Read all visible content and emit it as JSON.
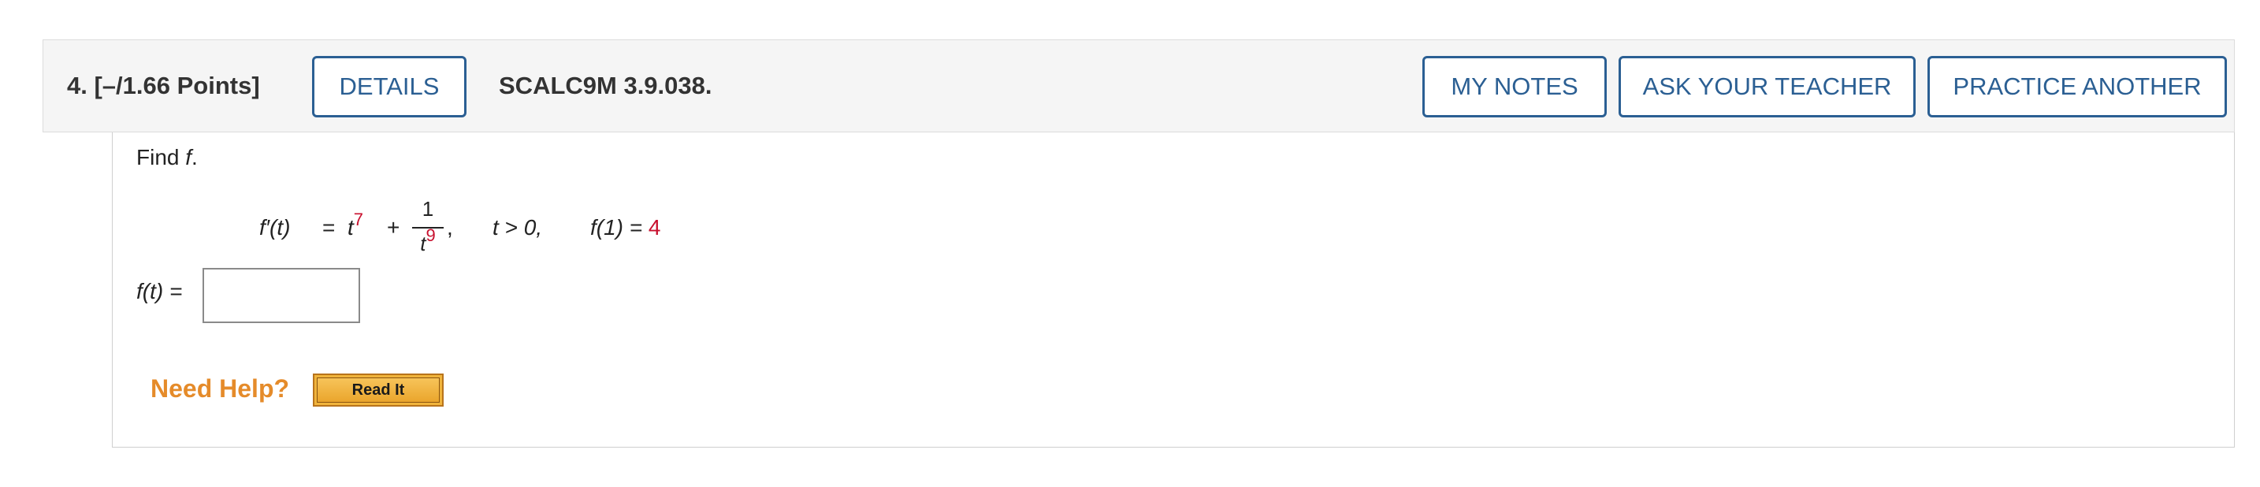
{
  "question": {
    "number_label": "4.",
    "points_label": "[–/1.66 Points]",
    "code": "SCALC9M 3.9.038."
  },
  "buttons": {
    "details": "DETAILS",
    "my_notes": "MY NOTES",
    "ask_teacher": "ASK YOUR TEACHER",
    "practice_another": "PRACTICE ANOTHER"
  },
  "body": {
    "find_prefix": "Find ",
    "find_var": "f",
    "find_suffix": ".",
    "equation": {
      "lhs": "f′(t)",
      "equals": "=",
      "t_base": "t",
      "t_exp": "7",
      "plus": "+",
      "frac_num": "1",
      "frac_den_base": "t",
      "frac_den_exp": "9",
      "comma1": ",",
      "condition": "t > 0,",
      "initial_lhs": "f(1) =",
      "initial_value": "4"
    },
    "answer_label": "f(t) =",
    "answer_value": "",
    "answer_placeholder": ""
  },
  "help": {
    "need_help": "Need Help?",
    "read_it": "Read It"
  },
  "colors": {
    "accent_blue": "#2b5f93",
    "highlight_red": "#c8102e",
    "help_orange": "#e58b2a",
    "read_it_gold": "#f0b43c"
  }
}
